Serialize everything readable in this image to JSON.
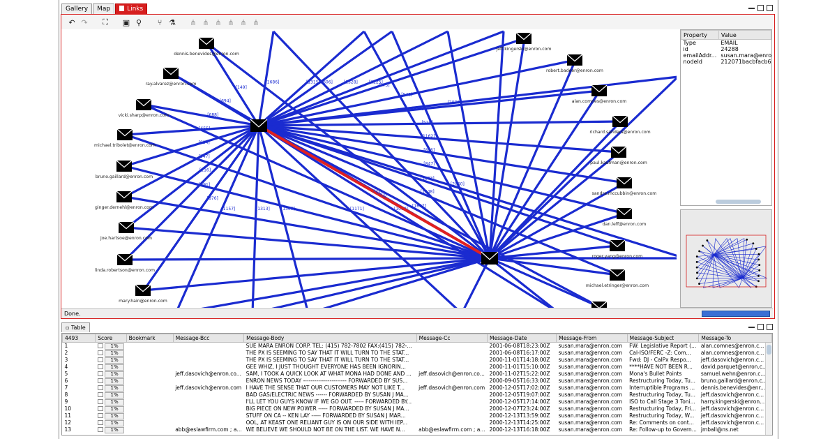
{
  "top_tabs": [
    {
      "label": "Gallery"
    },
    {
      "label": "Map"
    },
    {
      "label": "Links"
    }
  ],
  "status": {
    "text": "Done."
  },
  "properties": {
    "headers": [
      "Property",
      "Value"
    ],
    "rows": [
      [
        "Type",
        "EMAIL"
      ],
      [
        "id",
        "24288"
      ],
      [
        "emailAddr...",
        "susan.mara@enro..."
      ],
      [
        "nodeId",
        "212071bacbfacb63..."
      ]
    ]
  },
  "graph": {
    "hubs": [
      {
        "id": "h1",
        "label": ""
      },
      {
        "id": "h2",
        "label": ""
      }
    ],
    "nodes": [
      {
        "label": "dennis.benevides@enron.com"
      },
      {
        "label": "ray.alvarez@enron.com"
      },
      {
        "label": "vicki.sharp@enron.com"
      },
      {
        "label": "michael.tribolet@enron.com"
      },
      {
        "label": "bruno.gaillard@enron.com"
      },
      {
        "label": "ginger.dernehl@enron.com"
      },
      {
        "label": "joe.hartsoe@enron.com"
      },
      {
        "label": "linda.robertson@enron.com"
      },
      {
        "label": "mary.hain@enron.com"
      },
      {
        "label": "jeff.kingerski@enron.com"
      },
      {
        "label": "robert.badeer@enron.com"
      },
      {
        "label": "alan.comnes@enron.com"
      },
      {
        "label": "richard.sanders@enron.com"
      },
      {
        "label": "paul.kaufman@enron.com"
      },
      {
        "label": "sandra.mccubbin@enron.com"
      },
      {
        "label": "dan.leff@enron.com"
      },
      {
        "label": "roger.yang@enron.com"
      },
      {
        "label": "michael.etringer@enron.com"
      },
      {
        "label": ""
      }
    ],
    "edge_labels": [
      "[149]",
      "[694]",
      "[688]",
      "[655]",
      "[614]",
      "[547]",
      "[116]",
      "[591]",
      "[876]",
      "[773]",
      "[548]",
      "[556]",
      "[520]",
      "[1162]",
      "[825]",
      "[847]",
      "[1183]",
      "[1448]",
      "[1667]",
      "[1686]",
      "[3606]",
      "[1528]",
      "[2225]",
      "[1315]",
      "[1313]",
      "[1305]",
      "[1157]",
      "[1171]",
      "[1064]",
      "[2070]",
      "[2060]",
      "[4263]",
      "[911]",
      "[1288]",
      "[1290]",
      "[566]",
      "[568]",
      "[411]",
      "[726]"
    ],
    "highlight_label": "[4263]"
  },
  "table_tab": {
    "label": "Table"
  },
  "table": {
    "row_count": "4493",
    "columns": [
      "4493",
      "Score",
      "Bookmark",
      "Message-Bcc",
      "Message-Body",
      "Message-Cc",
      "Message-Date",
      "Message-From",
      "Message-Subject",
      "Message-To"
    ],
    "rows": [
      [
        "1",
        "1%",
        "",
        "",
        "SUE MARA ENRON CORP. TEL: (415) 782-7802 FAX:(415) 782-...",
        "",
        "2001-06-08T18:23:00Z",
        "susan.mara@enron.com",
        "FW: Legislative Report (...",
        "alan.comnes@enron.c..."
      ],
      [
        "2",
        "1%",
        "",
        "",
        "THE PX IS SEEMING TO SAY THAT IT WILL TURN TO THE STAT...",
        "",
        "2001-06-08T16:17:00Z",
        "susan.mara@enron.com",
        "Cal-ISO/FERC -Z: Com...",
        "alan.comnes@enron.c..."
      ],
      [
        "3",
        "1%",
        "",
        "",
        "THE PX IS SEEMING TO SAY THAT IT WILL TURN TO THE STAT...",
        "",
        "2000-11-01T14:18:00Z",
        "susan.mara@enron.com",
        "Fwd: DJ - CalPx Respo...",
        "jeff.dasovich@enron.c..."
      ],
      [
        "4",
        "1%",
        "",
        "",
        "GEE WHIZ, I JUST THOUGHT EVERYONE HAS BEEN IGNORIN...",
        "",
        "2000-11-01T15:10:00Z",
        "susan.mara@enron.com",
        "****HAVE NOT BEEN R...",
        "david.parquet@enron.c..."
      ],
      [
        "5",
        "1%",
        "",
        "jeff.dasovich@enron.co...",
        "SAM, I TOOK A QUICK LOOK AT WHAT MONA HAD DONE AND ...",
        "jeff.dasovich@enron.co...",
        "2000-11-02T15:22:00Z",
        "susan.mara@enron.com",
        "Mona's Bullet Points",
        "samuel.wehn@enron.c..."
      ],
      [
        "6",
        "1%",
        "",
        "",
        "ENRON NEWS TODAY ----------------------- FORWARDED BY SUS...",
        "",
        "2000-09-05T16:33:00Z",
        "susan.mara@enron.com",
        "Restructuring Today, Tu...",
        "bruno.gaillard@enron.c..."
      ],
      [
        "7",
        "1%",
        "",
        "jeff.dasovich@enron.com",
        "I HAVE THE SENSE THAT OUR CUSTOMERS MAY NOT LIKE T...",
        "jeff.dasovich@enron.com",
        "2000-12-05T17:02:00Z",
        "susan.mara@enron.com",
        "Interruptible Programs ...",
        "dennis.benevides@enr..."
      ],
      [
        "8",
        "1%",
        "",
        "",
        "BAD GAS/ELECTRIC NEWS ------ FORWARDED BY SUSAN J MA...",
        "",
        "2000-12-05T19:07:00Z",
        "susan.mara@enron.com",
        "Restructuring Today, Tu...",
        "jeff.dasovich@enron.c..."
      ],
      [
        "9",
        "1%",
        "",
        "",
        "I'LL LET YOU GUYS KNOW IF WE GO OUT. ----- FORWARDED BY...",
        "",
        "2000-12-05T17:14:00Z",
        "susan.mara@enron.com",
        "ISO to Call Stage 3 Toni...",
        "harry.kingerski@enron..."
      ],
      [
        "10",
        "1%",
        "",
        "",
        "BIG PIECE ON NEW POWER ----- FORWARDED BY SUSAN J MA...",
        "",
        "2000-12-07T23:24:00Z",
        "susan.mara@enron.com",
        "Restructuring Today, Fri...",
        "jeff.dasovich@enron.c..."
      ],
      [
        "11",
        "1%",
        "",
        "",
        "STUFF ON CA -- KEN LAY ----- FORWARDED BY SUSAN J MAR...",
        "",
        "2000-12-13T13:59:00Z",
        "susan.mara@enron.com",
        "Restructuring Today, W...",
        "jeff.dasovich@enron.c..."
      ],
      [
        "12",
        "1%",
        "",
        "",
        "OOL, AT KEAST ONE RELIANT GUY IS ON OUR SIDE WITH IEP...",
        "",
        "2000-12-13T14:25:00Z",
        "susan.mara@enron.com",
        "Re: Comments on cont...",
        "jeff.dasovich@enron.c..."
      ],
      [
        "13",
        "1%",
        "",
        "abb@eslawfirm.com ; a...",
        "WE BELIEVE WE SHOULD NOT BE ON THE LIST. WE HAVE N...",
        "abb@eslawfirm.com ; a...",
        "2000-12-13T16:18:00Z",
        "susan.mara@enron.com",
        "Re: Follow-up to Govern...",
        "jmball@ns.net"
      ]
    ]
  },
  "colors": {
    "accent": "#d61e1e",
    "edge": "#1a2bd0",
    "highlight_edge": "#e02020"
  }
}
